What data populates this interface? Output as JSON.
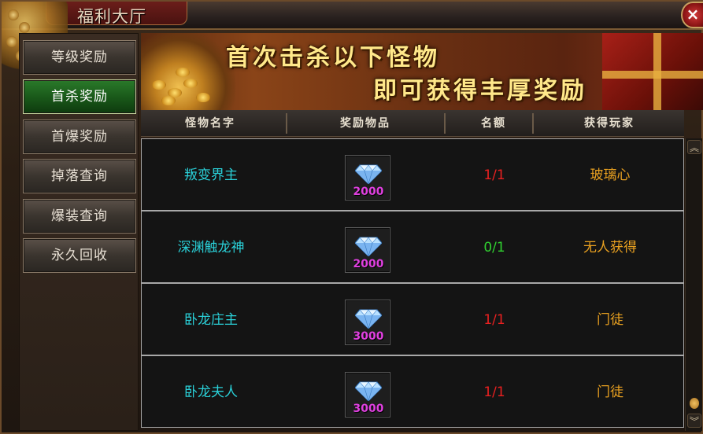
{
  "window": {
    "title": "福利大厅",
    "close_icon": "close-icon",
    "close_glyph": "×"
  },
  "sidebar": {
    "items": [
      {
        "label": "等级奖励",
        "active": false
      },
      {
        "label": "首杀奖励",
        "active": true
      },
      {
        "label": "首爆奖励",
        "active": false
      },
      {
        "label": "掉落查询",
        "active": false
      },
      {
        "label": "爆装查询",
        "active": false
      },
      {
        "label": "永久回收",
        "active": false
      }
    ]
  },
  "banner": {
    "line1": "首次击杀以下怪物",
    "line2": "即可获得丰厚奖励"
  },
  "table": {
    "headers": [
      "怪物名字",
      "奖励物品",
      "名额",
      "获得玩家"
    ],
    "rows": [
      {
        "monster": "叛变界主",
        "reward_icon": "diamond-icon",
        "reward_count": "2000",
        "quota": "1/1",
        "player": "玻璃心"
      },
      {
        "monster": "深渊触龙神",
        "reward_icon": "diamond-icon",
        "reward_count": "2000",
        "quota": "0/1",
        "player": "无人获得"
      },
      {
        "monster": "卧龙庄主",
        "reward_icon": "diamond-icon",
        "reward_count": "3000",
        "quota": "1/1",
        "player": "门徒"
      },
      {
        "monster": "卧龙夫人",
        "reward_icon": "diamond-icon",
        "reward_count": "3000",
        "quota": "1/1",
        "player": "门徒"
      }
    ]
  },
  "scrollbar": {
    "up_glyph": "︽",
    "down_glyph": "︾"
  },
  "colors": {
    "monster_name": "#2ad0d8",
    "quota_full": "#e82020",
    "quota_available": "#30d030",
    "player": "#e8a020",
    "reward_count": "#e040e0",
    "active_tab": "#1a5a1a"
  }
}
